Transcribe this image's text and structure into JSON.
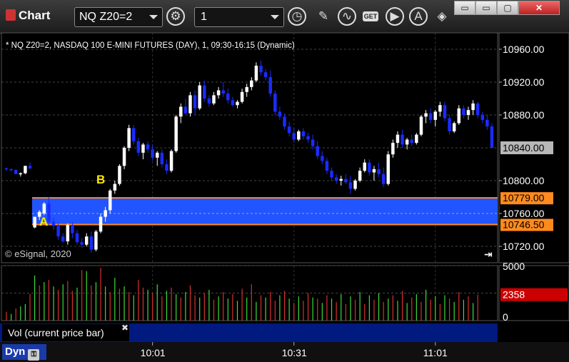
{
  "window": {
    "title": "Chart",
    "symbol": "NQ Z20=2",
    "interval": "1",
    "buttons": [
      "minimize-icon",
      "restore-icon",
      "maximize-icon",
      "close-icon"
    ]
  },
  "chart_header": "* NQ Z20=2, NASDAQ 100 E-MINI FUTURES (DAY), 1, 09:30-16:15 (Dynamic)",
  "copyright": "© eSignal, 2020",
  "colors": {
    "up": "#ffffff",
    "down": "#1a2bff",
    "zone": "#2255ff",
    "zone_line": "#ff8a1e",
    "vol_up": "#3ddc3d",
    "vol_down": "#d83030",
    "last_price": "#b8b8b8",
    "last_vol": "#cc0000"
  },
  "price_axis": {
    "ticks": [
      "10960.00",
      "10920.00",
      "10880.00",
      "10800.00",
      "10760.00",
      "10720.00"
    ],
    "last_price": "10840.00",
    "zone_high": "10779.00",
    "zone_low": "10746.50"
  },
  "volume_axis": {
    "ticks": [
      "5000",
      "0"
    ],
    "last_volume": "2358"
  },
  "time_axis": {
    "ticks": [
      "10:01",
      "10:31",
      "11:01"
    ]
  },
  "annotations": {
    "a": "A",
    "b": "B"
  },
  "volume_panel_label": "Vol (current price bar)",
  "dyn_label": "Dyn",
  "chart_data": {
    "type": "candlestick",
    "price_range": [
      10700,
      10980
    ],
    "zone": [
      10746.5,
      10779
    ],
    "last_price": 10840,
    "volume_range": [
      0,
      5000
    ],
    "last_volume": 2358,
    "start_time": "09:30",
    "bars": [
      [
        10815,
        10816,
        10812,
        10814
      ],
      [
        10814,
        10815,
        10811,
        10813
      ],
      [
        10813,
        10814,
        10808,
        10808
      ],
      [
        10808,
        10810,
        10805,
        10809
      ],
      [
        10809,
        10818,
        10808,
        10818
      ],
      [
        10818,
        10822,
        10814,
        10815
      ],
      [
        10743,
        10748,
        10742,
        10756
      ],
      [
        10756,
        10764,
        10752,
        10762
      ],
      [
        10760,
        10774,
        10758,
        10772
      ],
      [
        10772,
        10780,
        10745,
        10750
      ],
      [
        10750,
        10755,
        10740,
        10745
      ],
      [
        10745,
        10748,
        10728,
        10732
      ],
      [
        10732,
        10736,
        10724,
        10726
      ],
      [
        10726,
        10748,
        10722,
        10746
      ],
      [
        10746,
        10750,
        10730,
        10736
      ],
      [
        10736,
        10740,
        10722,
        10725
      ],
      [
        10725,
        10730,
        10718,
        10722
      ],
      [
        10722,
        10736,
        10720,
        10732
      ],
      [
        10732,
        10738,
        10712,
        10716
      ],
      [
        10716,
        10740,
        10714,
        10738
      ],
      [
        10738,
        10760,
        10736,
        10756
      ],
      [
        10756,
        10768,
        10750,
        10764
      ],
      [
        10764,
        10790,
        10760,
        10788
      ],
      [
        10788,
        10800,
        10784,
        10796
      ],
      [
        10796,
        10820,
        10794,
        10818
      ],
      [
        10818,
        10842,
        10814,
        10840
      ],
      [
        10840,
        10868,
        10836,
        10864
      ],
      [
        10864,
        10868,
        10844,
        10848
      ],
      [
        10848,
        10852,
        10830,
        10834
      ],
      [
        10834,
        10846,
        10826,
        10844
      ],
      [
        10844,
        10848,
        10834,
        10838
      ],
      [
        10838,
        10844,
        10824,
        10828
      ],
      [
        10828,
        10836,
        10818,
        10834
      ],
      [
        10834,
        10838,
        10816,
        10820
      ],
      [
        10820,
        10826,
        10808,
        10812
      ],
      [
        10812,
        10838,
        10810,
        10836
      ],
      [
        10836,
        10880,
        10834,
        10878
      ],
      [
        10878,
        10894,
        10870,
        10890
      ],
      [
        10890,
        10900,
        10880,
        10882
      ],
      [
        10882,
        10908,
        10878,
        10904
      ],
      [
        10904,
        10910,
        10880,
        10888
      ],
      [
        10888,
        10920,
        10886,
        10916
      ],
      [
        10916,
        10922,
        10896,
        10900
      ],
      [
        10900,
        10904,
        10890,
        10894
      ],
      [
        10894,
        10908,
        10892,
        10904
      ],
      [
        10904,
        10914,
        10900,
        10910
      ],
      [
        10910,
        10920,
        10902,
        10906
      ],
      [
        10906,
        10912,
        10894,
        10898
      ],
      [
        10898,
        10902,
        10890,
        10892
      ],
      [
        10892,
        10898,
        10888,
        10896
      ],
      [
        10896,
        10912,
        10894,
        10908
      ],
      [
        10908,
        10918,
        10902,
        10914
      ],
      [
        10914,
        10926,
        10910,
        10922
      ],
      [
        10922,
        10944,
        10920,
        10940
      ],
      [
        10940,
        10946,
        10928,
        10932
      ],
      [
        10932,
        10936,
        10922,
        10926
      ],
      [
        10926,
        10934,
        10902,
        10906
      ],
      [
        10906,
        10910,
        10880,
        10884
      ],
      [
        10884,
        10890,
        10874,
        10878
      ],
      [
        10878,
        10882,
        10862,
        10866
      ],
      [
        10866,
        10872,
        10854,
        10858
      ],
      [
        10858,
        10864,
        10846,
        10850
      ],
      [
        10850,
        10862,
        10848,
        10860
      ],
      [
        10860,
        10864,
        10850,
        10854
      ],
      [
        10854,
        10858,
        10846,
        10850
      ],
      [
        10850,
        10856,
        10838,
        10842
      ],
      [
        10842,
        10848,
        10826,
        10830
      ],
      [
        10830,
        10836,
        10820,
        10824
      ],
      [
        10824,
        10828,
        10808,
        10812
      ],
      [
        10812,
        10816,
        10800,
        10804
      ],
      [
        10804,
        10808,
        10796,
        10800
      ],
      [
        10800,
        10806,
        10794,
        10802
      ],
      [
        10802,
        10808,
        10796,
        10798
      ],
      [
        10798,
        10806,
        10784,
        10790
      ],
      [
        10790,
        10802,
        10788,
        10800
      ],
      [
        10800,
        10816,
        10798,
        10812
      ],
      [
        10812,
        10826,
        10810,
        10822
      ],
      [
        10822,
        10826,
        10806,
        10810
      ],
      [
        10810,
        10818,
        10800,
        10814
      ],
      [
        10814,
        10822,
        10804,
        10808
      ],
      [
        10808,
        10816,
        10792,
        10796
      ],
      [
        10796,
        10836,
        10794,
        10832
      ],
      [
        10832,
        10850,
        10828,
        10846
      ],
      [
        10846,
        10860,
        10840,
        10856
      ],
      [
        10856,
        10862,
        10840,
        10844
      ],
      [
        10844,
        10852,
        10838,
        10850
      ],
      [
        10850,
        10856,
        10842,
        10846
      ],
      [
        10846,
        10858,
        10844,
        10856
      ],
      [
        10856,
        10880,
        10854,
        10878
      ],
      [
        10878,
        10886,
        10870,
        10882
      ],
      [
        10882,
        10888,
        10870,
        10874
      ],
      [
        10874,
        10886,
        10866,
        10884
      ],
      [
        10884,
        10896,
        10878,
        10892
      ],
      [
        10892,
        10896,
        10872,
        10876
      ],
      [
        10876,
        10880,
        10856,
        10860
      ],
      [
        10860,
        10872,
        10858,
        10870
      ],
      [
        10870,
        10892,
        10868,
        10888
      ],
      [
        10888,
        10892,
        10876,
        10880
      ],
      [
        10880,
        10890,
        10874,
        10886
      ],
      [
        10886,
        10898,
        10880,
        10894
      ],
      [
        10894,
        10896,
        10876,
        10880
      ],
      [
        10880,
        10884,
        10870,
        10874
      ],
      [
        10874,
        10880,
        10862,
        10866
      ],
      [
        10866,
        10870,
        10844,
        10840
      ]
    ],
    "volumes": [
      [
        800,
        0
      ],
      [
        600,
        1
      ],
      [
        1100,
        0
      ],
      [
        1300,
        1
      ],
      [
        1500,
        1
      ],
      [
        2400,
        0
      ],
      [
        4100,
        1
      ],
      [
        3200,
        0
      ],
      [
        3500,
        1
      ],
      [
        3700,
        0
      ],
      [
        3100,
        1
      ],
      [
        2800,
        0
      ],
      [
        3300,
        1
      ],
      [
        3600,
        0
      ],
      [
        2700,
        0
      ],
      [
        3000,
        1
      ],
      [
        4600,
        0
      ],
      [
        4500,
        1
      ],
      [
        3200,
        0
      ],
      [
        3500,
        1
      ],
      [
        4800,
        0
      ],
      [
        3100,
        1
      ],
      [
        2600,
        0
      ],
      [
        3900,
        1
      ],
      [
        2900,
        0
      ],
      [
        3100,
        1
      ],
      [
        2600,
        0
      ],
      [
        2300,
        1
      ],
      [
        3700,
        0
      ],
      [
        3000,
        0
      ],
      [
        2800,
        1
      ],
      [
        2500,
        0
      ],
      [
        3300,
        1
      ],
      [
        2200,
        0
      ],
      [
        2700,
        1
      ],
      [
        3000,
        0
      ],
      [
        2400,
        1
      ],
      [
        2100,
        0
      ],
      [
        2600,
        1
      ],
      [
        3200,
        0
      ],
      [
        2300,
        0
      ],
      [
        2100,
        1
      ],
      [
        2500,
        0
      ],
      [
        2800,
        1
      ],
      [
        1900,
        0
      ],
      [
        2200,
        1
      ],
      [
        2600,
        0
      ],
      [
        2000,
        1
      ],
      [
        2400,
        0
      ],
      [
        1800,
        1
      ],
      [
        2900,
        0
      ],
      [
        2100,
        1
      ],
      [
        3300,
        0
      ],
      [
        1700,
        1
      ],
      [
        2300,
        0
      ],
      [
        2100,
        1
      ],
      [
        2600,
        0
      ],
      [
        1800,
        0
      ],
      [
        2300,
        1
      ],
      [
        2700,
        0
      ],
      [
        2000,
        1
      ],
      [
        1600,
        0
      ],
      [
        2200,
        1
      ],
      [
        1800,
        0
      ],
      [
        2500,
        0
      ],
      [
        2100,
        1
      ],
      [
        2000,
        0
      ],
      [
        1600,
        1
      ],
      [
        2300,
        0
      ],
      [
        2000,
        1
      ],
      [
        1700,
        0
      ],
      [
        2400,
        1
      ],
      [
        1500,
        0
      ],
      [
        2200,
        1
      ],
      [
        1900,
        0
      ],
      [
        2600,
        1
      ],
      [
        1500,
        0
      ],
      [
        2300,
        1
      ],
      [
        1900,
        0
      ],
      [
        2500,
        1
      ],
      [
        1700,
        0
      ],
      [
        2000,
        1
      ],
      [
        2300,
        0
      ],
      [
        1800,
        1
      ],
      [
        2700,
        0
      ],
      [
        1600,
        1
      ],
      [
        2100,
        0
      ],
      [
        2400,
        1
      ],
      [
        1700,
        0
      ],
      [
        2800,
        1
      ],
      [
        1900,
        0
      ],
      [
        2200,
        1
      ],
      [
        1500,
        0
      ],
      [
        2300,
        1
      ],
      [
        2000,
        0
      ],
      [
        1700,
        1
      ],
      [
        2600,
        0
      ],
      [
        1900,
        1
      ],
      [
        2200,
        0
      ],
      [
        1600,
        1
      ],
      [
        2358,
        0
      ]
    ]
  }
}
